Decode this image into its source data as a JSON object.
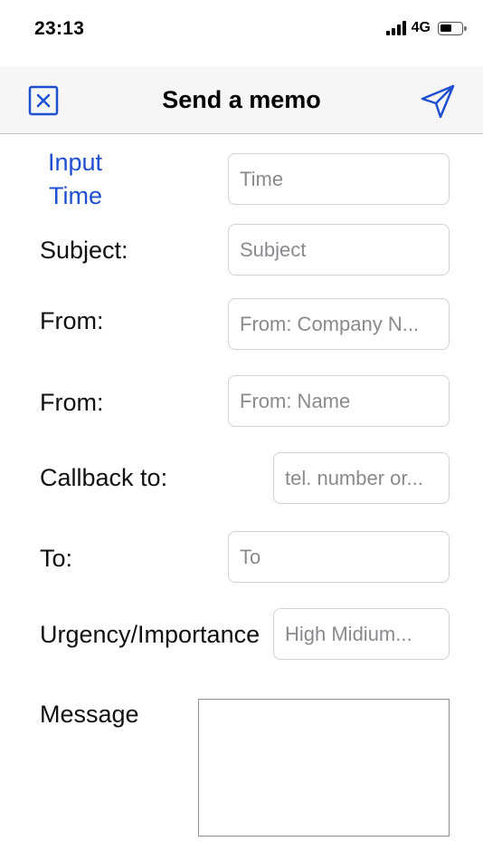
{
  "status_bar": {
    "time": "23:13",
    "network": "4G",
    "battery_level": 0.55
  },
  "nav": {
    "title": "Send a memo",
    "close_icon": "close-square-icon",
    "send_icon": "paper-plane-icon",
    "accent_color": "#1f4fd1"
  },
  "form": {
    "input_time_link": {
      "line1": "Input",
      "line2": "Time"
    },
    "time_placeholder": "Time",
    "subject_label": "Subject:",
    "subject_placeholder": "Subject",
    "from_company_label": "From:",
    "from_company_placeholder": "From: Company N...",
    "from_name_label": "From:",
    "from_name_placeholder": "From: Name",
    "callback_label": "Callback to:",
    "callback_placeholder": "tel. number or...",
    "to_label": "To:",
    "to_placeholder": "To",
    "urgency_label": "Urgency/Importance",
    "urgency_placeholder": "High Midium...",
    "message_label": "Message"
  }
}
